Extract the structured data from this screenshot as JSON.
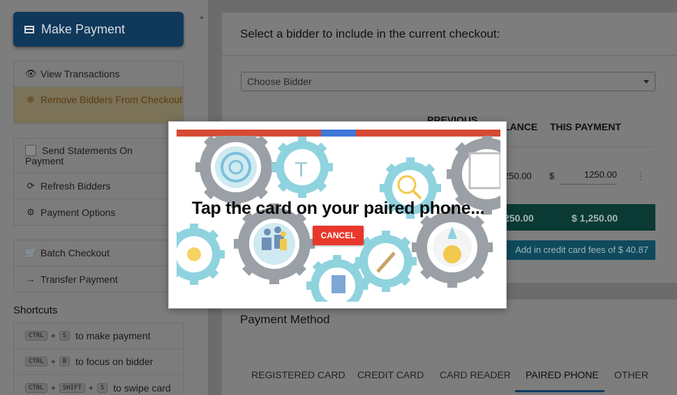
{
  "sidebar": {
    "make_payment": "Make Payment",
    "group1": [
      {
        "icon": "eye-icon",
        "label": "View Transactions"
      },
      {
        "icon": "x-circle-icon",
        "label": "Remove Bidders From Checkout"
      }
    ],
    "group2": [
      {
        "icon": "checkbox",
        "label": "Send Statements On Payment"
      },
      {
        "icon": "refresh-icon",
        "label": "Refresh Bidders"
      },
      {
        "icon": "gear-icon",
        "label": "Payment Options"
      }
    ],
    "group3": [
      {
        "icon": "cart-icon",
        "label": "Batch Checkout"
      },
      {
        "icon": "arrow-right-icon",
        "label": "Transfer Payment"
      }
    ],
    "shortcuts_title": "Shortcuts",
    "shortcuts": [
      {
        "keys": [
          "CTRL",
          "S"
        ],
        "text": "to make payment"
      },
      {
        "keys": [
          "CTRL",
          "B"
        ],
        "text": "to focus on bidder"
      },
      {
        "keys": [
          "CTRL",
          "SHIFT",
          "S"
        ],
        "text": "to swipe card"
      }
    ]
  },
  "main": {
    "select_bidder_heading": "Select a bidder to include in the current checkout:",
    "bidder_select_placeholder": "Choose Bidder",
    "headers": {
      "previous": "PREVIOUS",
      "balance": "LANCE",
      "this_payment": "THIS PAYMENT"
    },
    "row": {
      "balance": "250.00",
      "currency": "$",
      "payment": "1250.00"
    },
    "totals": {
      "balance": "250.00",
      "payment": "$ 1,250.00"
    },
    "fee_button": "Add in credit card fees of $ 40.87",
    "payment_method_heading": "Payment Method",
    "tabs": [
      "REGISTERED CARD",
      "CREDIT CARD",
      "CARD READER",
      "PAIRED PHONE",
      "OTHER"
    ],
    "active_tab": "PAIRED PHONE"
  },
  "modal": {
    "message": "Tap the card on your paired phone...",
    "cancel_label": "CANCEL",
    "progress_percent": 55
  },
  "colors": {
    "progress_bar": "#d64a34",
    "progress_segment": "#3f76d8",
    "cancel_button": "#e9382b",
    "gear_gray": "#9aa0a6",
    "gear_teal": "#8fd3df"
  }
}
